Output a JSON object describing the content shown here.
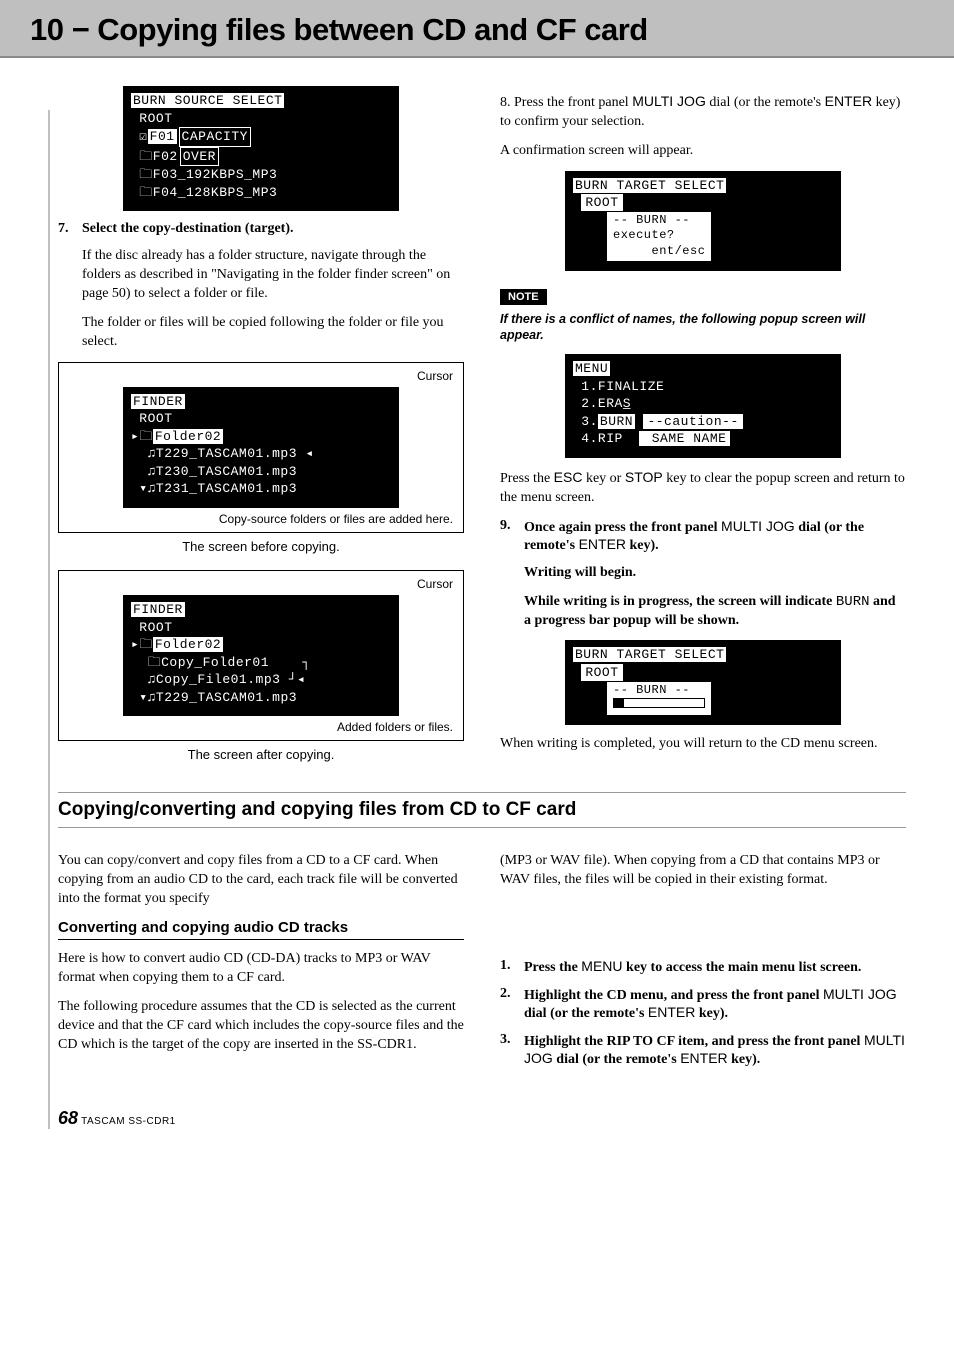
{
  "header": {
    "title": "10 − Copying files between CD and CF card"
  },
  "left": {
    "lcd1": {
      "l1": "BURN SOURCE SELECT",
      "l2": " ROOT",
      "l3a": " ☑",
      "l3b": "F01",
      "l3popup1": "CAPACITY",
      "l4a": " 🗀F02",
      "l4popup2": "OVER",
      "l5": " 🗀F03_192KBPS_MP3",
      "l6": " 🗀F04_128KBPS_MP3"
    },
    "step7num": "7.",
    "step7": "Select the copy-destination (target).",
    "p1": "If the disc already has a folder structure, navigate through the folders as described in \"Navigating in the folder finder screen\" on page 50) to select a folder or file.",
    "p2": "The folder or files will be copied following the folder or file you select.",
    "callout_cursor": "Cursor",
    "lcd2": {
      "l1": "FINDER",
      "l2": " ROOT",
      "l3a": "▸🗀",
      "l3b": "Folder02",
      "l4": "  ♫T229_TASCAM01.mp3 ◂",
      "l5": "  ♫T230_TASCAM01.mp3",
      "l6": " ▾♫T231_TASCAM01.mp3"
    },
    "callout_copy": "Copy-source folders or files are added here.",
    "caption1": "The screen before copying.",
    "lcd3": {
      "l1": "FINDER",
      "l2": " ROOT",
      "l3a": "▸🗀",
      "l3b": "Folder02",
      "l4": "  🗀Copy_Folder01    ┐",
      "l5": "  ♫Copy_File01.mp3 ┘◂",
      "l6": " ▾♫T229_TASCAM01.mp3"
    },
    "callout_added": "Added folders or files.",
    "caption2": "The screen after copying."
  },
  "right": {
    "p8a": "8. Press the front panel ",
    "p8key1": "MULTI JOG",
    "p8b": " dial (or the remote's ",
    "p8key2": "ENTER",
    "p8c": " key) to confirm your selection.",
    "p_conf": "A confirmation screen will appear.",
    "lcd4": {
      "l1": "BURN TARGET SELECT",
      "l2": "ROOT",
      "pop1": "-- BURN --",
      "pop2": "execute?",
      "pop3": "     ent/esc"
    },
    "note_label": "NOTE",
    "note_text": "If there is a conflict of names, the following popup screen will appear.",
    "lcd5": {
      "l1": "MENU",
      "l2": " 1.FINALIZE",
      "l3": " 2.ERAS̲",
      "l4a": " 3.",
      "l4b": "BURN",
      "pop1": "--caution--",
      "pop2": " SAME NAME",
      "l5": " 4.RIP"
    },
    "p_esc_a": "Press the ",
    "p_esc_k1": "ESC",
    "p_esc_b": " key or ",
    "p_esc_k2": "STOP",
    "p_esc_c": " key to clear the popup screen and return to the menu screen.",
    "step9num": "9.",
    "step9a": "Once again press the front panel ",
    "step9k1": "MULTI JOG",
    "step9b": " dial (or the remote's ",
    "step9k2": "ENTER",
    "step9c": " key).",
    "p_write": "Writing will begin.",
    "p_prog_a": "While writing is in progress, the screen will indicate ",
    "p_prog_mono": "BURN",
    "p_prog_b": " and a progress bar popup will be shown.",
    "lcd6": {
      "l1": "BURN TARGET SELECT",
      "l2": "ROOT",
      "pop1": "-- BURN --",
      "bar": "▭"
    },
    "p_done": "When writing is completed, you will return to the CD menu screen."
  },
  "section2": {
    "heading": "Copying/converting and copying files from CD to CF card",
    "left_p1": "You can copy/convert and copy files from a CD to a CF card. When copying from an audio CD to the card, each track file will be converted into the format you specify",
    "right_p1": "(MP3 or WAV file). When copying from a CD that contains MP3 or WAV files, the files will be copied in their existing format.",
    "sub": "Converting and copying audio CD tracks",
    "left_p2": "Here is how to convert audio CD (CD-DA) tracks to MP3 or WAV format when copying them to a CF card.",
    "left_p3": "The following procedure assumes that the CD is selected as the current device and that the CF card which includes the copy-source files and the CD which is the target of the copy are inserted in the SS-CDR1.",
    "s1num": "1.",
    "s1a": "Press the ",
    "s1k": "MENU",
    "s1b": " key to access the main menu list screen.",
    "s2num": "2.",
    "s2a": "Highlight the CD menu, and press the front panel ",
    "s2k1": "MULTI JOG",
    "s2b": " dial (or the remote's ",
    "s2k2": "ENTER",
    "s2c": " key).",
    "s3num": "3.",
    "s3a": "Highlight the RIP TO CF item, and press the front panel ",
    "s3k1": "MULTI JOG",
    "s3b": " dial (or the remote's ",
    "s3k2": "ENTER",
    "s3c": " key)."
  },
  "footer": {
    "page": "68",
    "product": " TASCAM  SS-CDR1"
  }
}
